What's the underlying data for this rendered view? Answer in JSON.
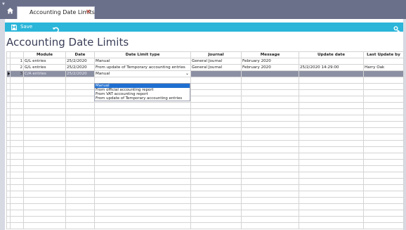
{
  "tab": {
    "title": "Accounting Date Limits",
    "close": "×"
  },
  "toolbar": {
    "save_label": "Save"
  },
  "page": {
    "title": "Accounting Date Limits"
  },
  "table": {
    "columns": [
      "Module",
      "Date",
      "Date Limit type",
      "Journal",
      "Message",
      "Update date",
      "Last Update by"
    ],
    "rows": [
      {
        "num": "1",
        "module": "G/L entries",
        "date": "25/2/2020",
        "type": "Manual",
        "journal": "General Journal",
        "message": "February 2020",
        "update_date": "",
        "update_by": ""
      },
      {
        "num": "2",
        "module": "G/L entries",
        "date": "25/2/2020",
        "type": "From update of Temporary accounting entries",
        "journal": "General Journal",
        "message": "February 2020",
        "update_date": "25/2/2020 14:29:00",
        "update_by": "Harry Oak"
      },
      {
        "num": "3",
        "module": "C/A entries",
        "date": "25/2/2020",
        "type": "Manual",
        "journal": "",
        "message": "",
        "update_date": "",
        "update_by": ""
      }
    ],
    "indicator": "▶"
  },
  "dropdown": {
    "selected": "Manual",
    "options": [
      "Manual",
      "From official accounting report",
      "From VAT accounting report",
      "From update of Temporary accounting entries"
    ]
  },
  "colors": {
    "toolbar": "#2ab5d9",
    "tabstrip": "#6a6f8a",
    "selected_row": "#8c90a3",
    "option_highlight": "#1f6fd1"
  }
}
